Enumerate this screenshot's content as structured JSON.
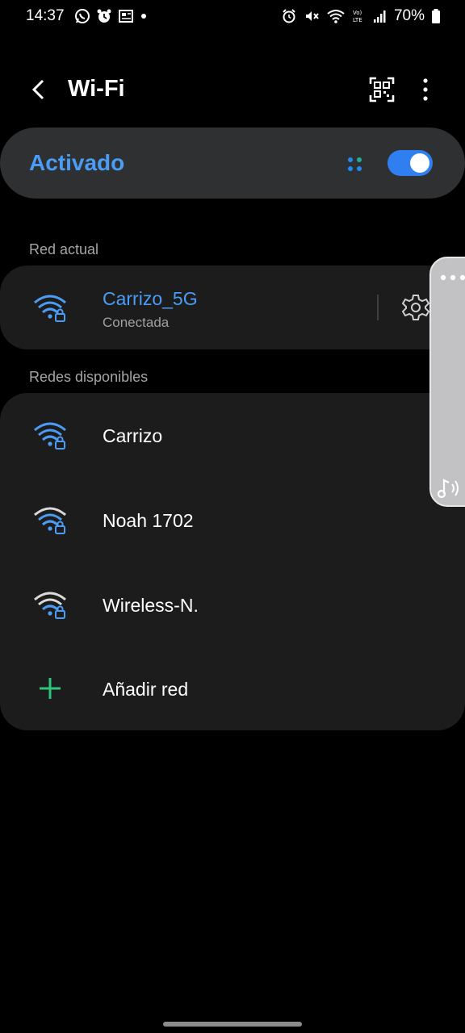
{
  "status_bar": {
    "time": "14:37",
    "battery_percent": "70%",
    "notification_icons": [
      "whatsapp-icon",
      "alarm-app-icon",
      "news-icon",
      "dot-icon"
    ],
    "system_icons": [
      "alarm-icon",
      "mute-icon",
      "wifi-icon",
      "volte-icon",
      "signal-icon",
      "battery-icon"
    ]
  },
  "app_bar": {
    "title": "Wi-Fi"
  },
  "master_toggle": {
    "label": "Activado",
    "on": true,
    "accent_color": "#2f7ff0"
  },
  "current_network": {
    "header": "Red actual",
    "name": "Carrizo_5G",
    "status": "Conectada"
  },
  "available_networks": {
    "header": "Redes disponibles",
    "items": [
      {
        "name": "Carrizo",
        "icon": "wifi-lock-icon"
      },
      {
        "name": "Noah 1702",
        "icon": "wifi-lock-icon"
      },
      {
        "name": "Wireless-N.",
        "icon": "wifi-lock-icon"
      }
    ],
    "add_label": "Añadir red"
  }
}
